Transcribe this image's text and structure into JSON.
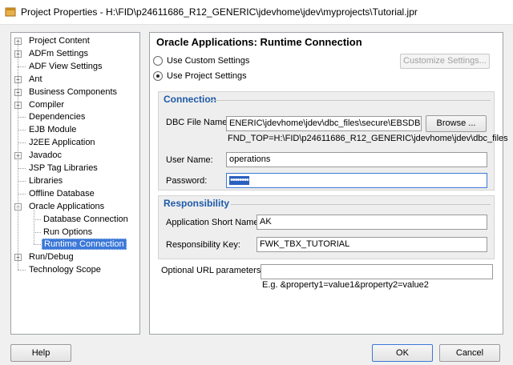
{
  "window": {
    "title": "Project Properties - H:\\FID\\p24611686_R12_GENERIC\\jdevhome\\jdev\\myprojects\\Tutorial.jpr"
  },
  "tree": {
    "items": [
      {
        "label": "Project Content",
        "expandable": true
      },
      {
        "label": "ADFm Settings",
        "expandable": true
      },
      {
        "label": "ADF View Settings",
        "expandable": false
      },
      {
        "label": "Ant",
        "expandable": true
      },
      {
        "label": "Business Components",
        "expandable": true
      },
      {
        "label": "Compiler",
        "expandable": true
      },
      {
        "label": "Dependencies",
        "expandable": false
      },
      {
        "label": "EJB Module",
        "expandable": false
      },
      {
        "label": "J2EE Application",
        "expandable": false
      },
      {
        "label": "Javadoc",
        "expandable": true
      },
      {
        "label": "JSP Tag Libraries",
        "expandable": false
      },
      {
        "label": "Libraries",
        "expandable": false
      },
      {
        "label": "Offline Database",
        "expandable": false
      },
      {
        "label": "Oracle Applications",
        "expandable": true,
        "expanded": true
      },
      {
        "label": "Database Connection",
        "child": true
      },
      {
        "label": "Run Options",
        "child": true
      },
      {
        "label": "Runtime Connection",
        "child": true,
        "selected": true
      },
      {
        "label": "Run/Debug",
        "expandable": true
      },
      {
        "label": "Technology Scope",
        "expandable": false
      }
    ]
  },
  "panel": {
    "title": "Oracle Applications: Runtime Connection",
    "radio_custom": "Use Custom Settings",
    "radio_project": "Use Project Settings",
    "selected_radio": "project",
    "customize_button": "Customize Settings...",
    "connection": {
      "heading": "Connection",
      "dbc_label": "DBC File Name:",
      "dbc_value": "ENERIC\\jdevhome\\jdev\\dbc_files\\secure\\EBSDB.dbc",
      "browse_button": "Browse ...",
      "fnd_top": "FND_TOP=H:\\FID\\p24611686_R12_GENERIC\\jdevhome\\jdev\\dbc_files",
      "user_label": "User Name:",
      "user_value": "operations",
      "password_label": "Password:",
      "password_mask": "••••••••"
    },
    "responsibility": {
      "heading": "Responsibility",
      "app_label": "Application Short Name:",
      "app_value": "AK",
      "key_label": "Responsibility Key:",
      "key_value": "FWK_TBX_TUTORIAL"
    },
    "optional_url_label": "Optional URL parameters:",
    "optional_url_value": "",
    "example": "E.g. &property1=value1&property2=value2"
  },
  "buttons": {
    "help": "Help",
    "ok": "OK",
    "cancel": "Cancel"
  },
  "colors": {
    "selection": "#3b78d8",
    "group_heading": "#1d5aa8"
  }
}
